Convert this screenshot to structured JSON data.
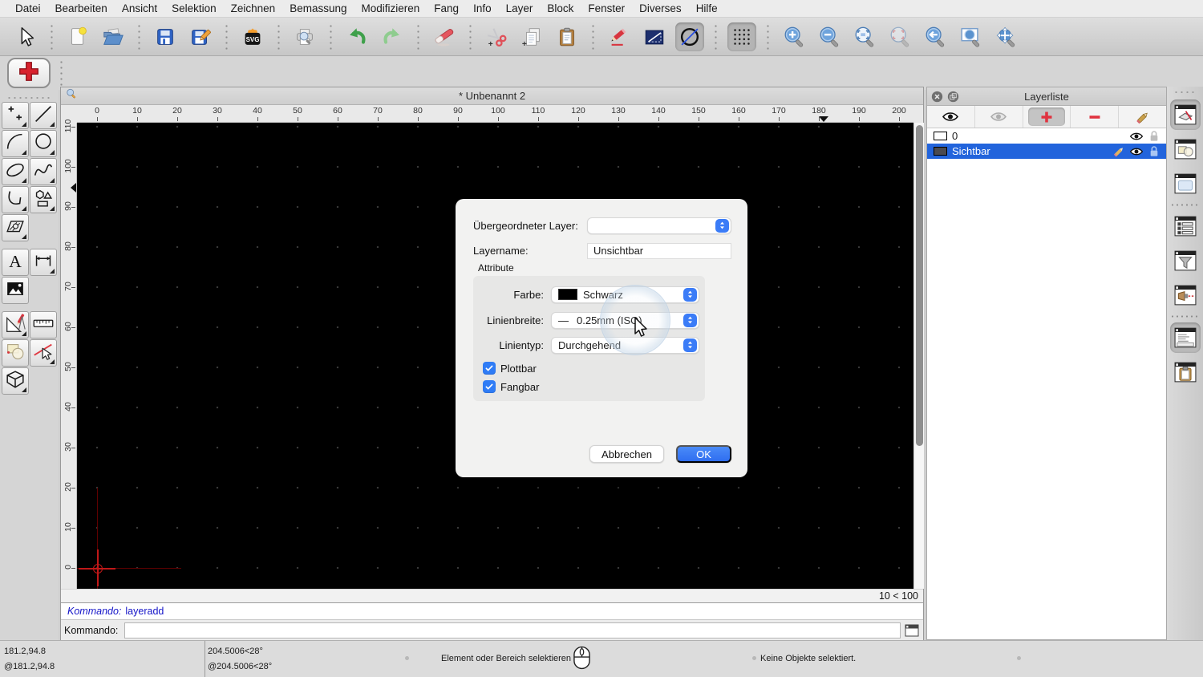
{
  "menubar": {
    "items": [
      "Datei",
      "Bearbeiten",
      "Ansicht",
      "Selektion",
      "Zeichnen",
      "Bemassung",
      "Modifizieren",
      "Fang",
      "Info",
      "Layer",
      "Block",
      "Fenster",
      "Diverses",
      "Hilfe"
    ]
  },
  "toolbar": {
    "groups": [
      {
        "items": [
          {
            "name": "select-arrow"
          }
        ]
      },
      {
        "items": [
          {
            "name": "new-document"
          },
          {
            "name": "open-file"
          }
        ]
      },
      {
        "items": [
          {
            "name": "save"
          },
          {
            "name": "save-as"
          }
        ]
      },
      {
        "items": [
          {
            "name": "svg-export"
          }
        ]
      },
      {
        "items": [
          {
            "name": "print-preview"
          }
        ]
      },
      {
        "items": [
          {
            "name": "undo"
          },
          {
            "name": "redo"
          }
        ]
      },
      {
        "items": [
          {
            "name": "delete-eraser"
          }
        ]
      },
      {
        "items": [
          {
            "name": "cut"
          },
          {
            "name": "copy"
          },
          {
            "name": "paste"
          }
        ]
      },
      {
        "items": [
          {
            "name": "edit-attributes"
          },
          {
            "name": "line-attributes"
          },
          {
            "name": "draft-mode",
            "pressed": true
          }
        ]
      },
      {
        "items": [
          {
            "name": "grid-toggle",
            "pressed": true
          }
        ]
      },
      {
        "items": [
          {
            "name": "zoom-in"
          },
          {
            "name": "zoom-out"
          },
          {
            "name": "zoom-auto"
          },
          {
            "name": "zoom-selection",
            "disabled": true
          },
          {
            "name": "zoom-previous"
          },
          {
            "name": "zoom-window"
          },
          {
            "name": "zoom-pan"
          }
        ]
      }
    ]
  },
  "action_bar": {
    "current_tool_icon": "add-layer-plus"
  },
  "tool_palette": {
    "rows": [
      {
        "tools": [
          {
            "name": "points",
            "corner": true
          },
          {
            "name": "line",
            "corner": true
          }
        ]
      },
      {
        "tools": [
          {
            "name": "arc",
            "corner": true
          },
          {
            "name": "circle",
            "corner": true
          }
        ]
      },
      {
        "tools": [
          {
            "name": "ellipse",
            "corner": true
          },
          {
            "name": "spline",
            "corner": true
          }
        ]
      },
      {
        "tools": [
          {
            "name": "polyline",
            "corner": true
          },
          {
            "name": "shapes",
            "corner": true
          }
        ]
      },
      {
        "tools": [
          {
            "name": "hatch",
            "corner": true
          }
        ]
      },
      {
        "gap": true,
        "tools": [
          {
            "name": "text",
            "corner": false
          },
          {
            "name": "dimension",
            "corner": true
          }
        ]
      },
      {
        "tools": [
          {
            "name": "image",
            "corner": false
          }
        ]
      },
      {
        "gap": true,
        "tools": [
          {
            "name": "construct",
            "corner": true
          },
          {
            "name": "measure",
            "corner": false
          }
        ]
      },
      {
        "tools": [
          {
            "name": "modify",
            "corner": false
          },
          {
            "name": "select-entity",
            "corner": true
          }
        ]
      },
      {
        "tools": [
          {
            "name": "solid",
            "corner": true
          }
        ]
      }
    ]
  },
  "document": {
    "title": "* Unbenannt 2",
    "zoom_status": "10 < 100",
    "ruler_h": {
      "ticks": [
        0,
        10,
        20,
        30,
        40,
        50,
        60,
        70,
        80,
        90,
        100,
        110,
        120,
        130,
        140,
        150,
        160,
        170,
        180,
        190,
        200
      ],
      "marker_value": 181.2
    },
    "ruler_v": {
      "ticks": [
        0,
        10,
        20,
        30,
        40,
        50,
        60,
        70,
        80,
        90,
        100,
        110
      ],
      "marker_value": 94.8
    }
  },
  "command": {
    "history_label": "Kommando:",
    "history_value": "layeradd",
    "input_label": "Kommando:",
    "input_value": ""
  },
  "layer_panel": {
    "title": "Layerliste",
    "toolbar": [
      {
        "name": "show-all-layers",
        "icon": "eye"
      },
      {
        "name": "hide-inactive-layers",
        "icon": "eye-faded"
      },
      {
        "name": "add-layer",
        "icon": "plus-red",
        "pressed": true
      },
      {
        "name": "remove-layer",
        "icon": "minus-red"
      },
      {
        "name": "edit-layer",
        "icon": "pencil"
      }
    ],
    "layers": [
      {
        "name": "0",
        "selected": false,
        "swatch": "#ffffff",
        "has_pencil": false
      },
      {
        "name": "Sichtbar",
        "selected": true,
        "swatch": "#4a4a50",
        "has_pencil": true
      }
    ]
  },
  "dock": {
    "buttons": [
      {
        "name": "layer-list-panel",
        "pressed": true
      },
      {
        "name": "block-list-panel",
        "pressed": false
      },
      {
        "name": "library-browser-panel",
        "pressed": false
      },
      {
        "name": "entity-list-panel",
        "pressed": false,
        "sep_before": true
      },
      {
        "name": "selection-filter-panel",
        "pressed": false
      },
      {
        "name": "reference-panel",
        "pressed": false
      },
      {
        "name": "command-line-panel",
        "pressed": true,
        "sep_before": true
      },
      {
        "name": "clipboard-panel",
        "pressed": false
      }
    ]
  },
  "dialog": {
    "parent_layer_label": "Übergeordneter Layer:",
    "parent_layer_value": "",
    "layer_name_label": "Layername:",
    "layer_name_value": "Unsichtbar",
    "attributes_label": "Attribute",
    "color_label": "Farbe:",
    "color_value": "Schwarz",
    "line_width_label": "Linienbreite:",
    "line_width_dash": "—",
    "line_width_value": "0.25mm (ISO)",
    "line_type_label": "Linientyp:",
    "line_type_value": "Durchgehend",
    "plottable_label": "Plottbar",
    "plottable_checked": true,
    "snappable_label": "Fangbar",
    "snappable_checked": true,
    "cancel_label": "Abbrechen",
    "ok_label": "OK"
  },
  "statusbar": {
    "abs_coord": "181.2,94.8",
    "rel_coord": "@181.2,94.8",
    "abs_polar": "204.5006<28°",
    "rel_polar": "@204.5006<28°",
    "hint": "Element oder Bereich selektieren",
    "selection_status": "Keine Objekte selektiert."
  },
  "colors": {
    "accent": "#3b7cf7",
    "selection_blue": "#2264dc",
    "canvas_black": "#000000",
    "crosshair_red": "#c01818",
    "add_red": "#d8222e"
  }
}
